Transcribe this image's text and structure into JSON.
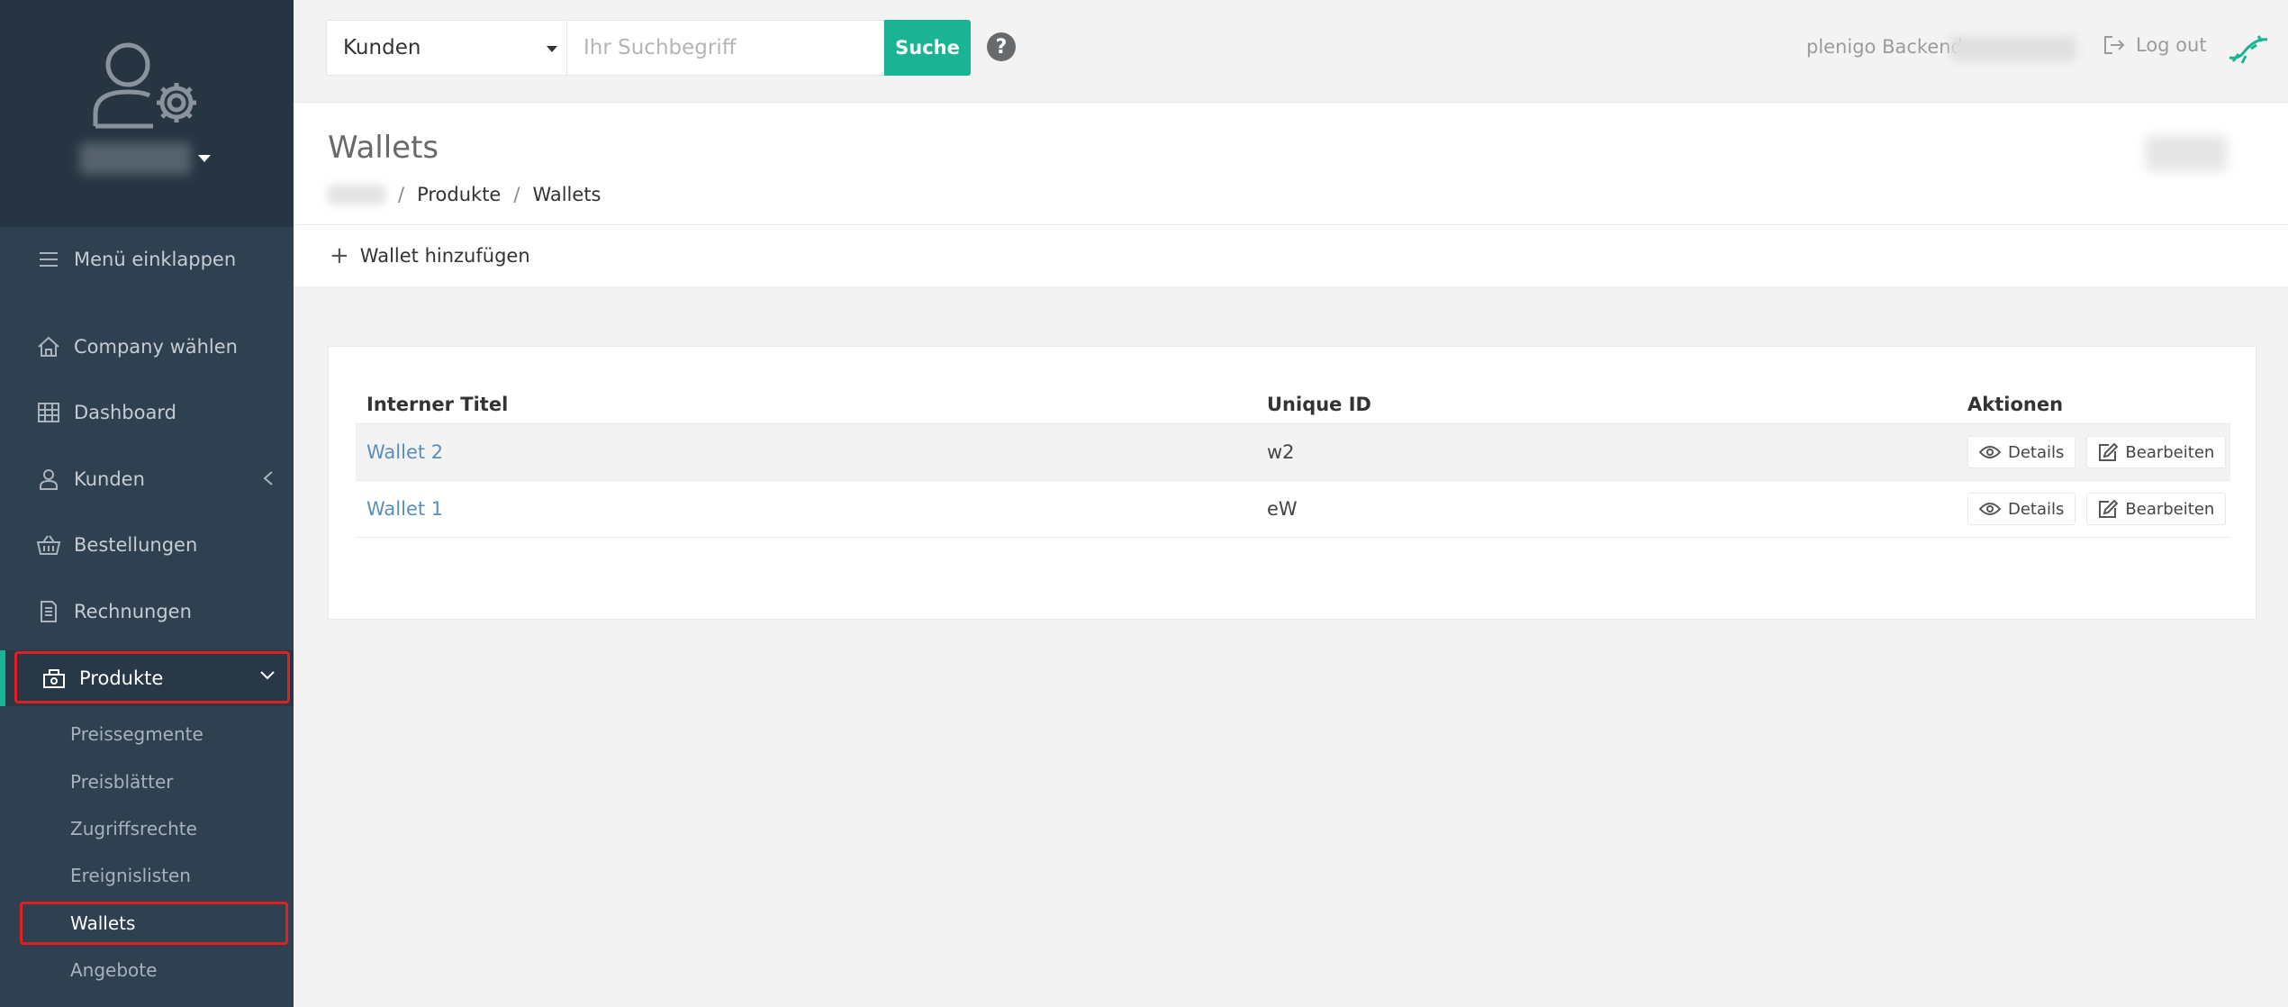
{
  "sidebar": {
    "collapse_label": "Menü einklappen",
    "items": [
      {
        "label": "Company wählen"
      },
      {
        "label": "Dashboard"
      },
      {
        "label": "Kunden"
      },
      {
        "label": "Bestellungen"
      },
      {
        "label": "Rechnungen"
      },
      {
        "label": "Produkte"
      }
    ],
    "sub_items": [
      {
        "label": "Preissegmente"
      },
      {
        "label": "Preisblätter"
      },
      {
        "label": "Zugriffsrechte"
      },
      {
        "label": "Ereignislisten"
      },
      {
        "label": "Wallets"
      },
      {
        "label": "Angebote"
      }
    ]
  },
  "topbar": {
    "search_scope": "Kunden",
    "search_placeholder": "Ihr Suchbegriff",
    "search_button": "Suche",
    "help_icon": "?",
    "backend_label": "plenigo Backend",
    "logout_label": "Log out"
  },
  "page": {
    "title": "Wallets",
    "breadcrumb": [
      "Produkte",
      "Wallets"
    ],
    "add_button": "Wallet hinzufügen"
  },
  "table": {
    "headers": [
      "Interner Titel",
      "Unique ID",
      "Aktionen"
    ],
    "rows": [
      {
        "title": "Wallet 2",
        "uid": "w2",
        "details": "Details",
        "edit": "Bearbeiten"
      },
      {
        "title": "Wallet 1",
        "uid": "eW",
        "details": "Details",
        "edit": "Bearbeiten"
      }
    ]
  },
  "colors": {
    "accent": "#1ab394",
    "sidebar_bg": "#2f4050",
    "highlight": "#e02020",
    "link": "#5b8fb9"
  }
}
